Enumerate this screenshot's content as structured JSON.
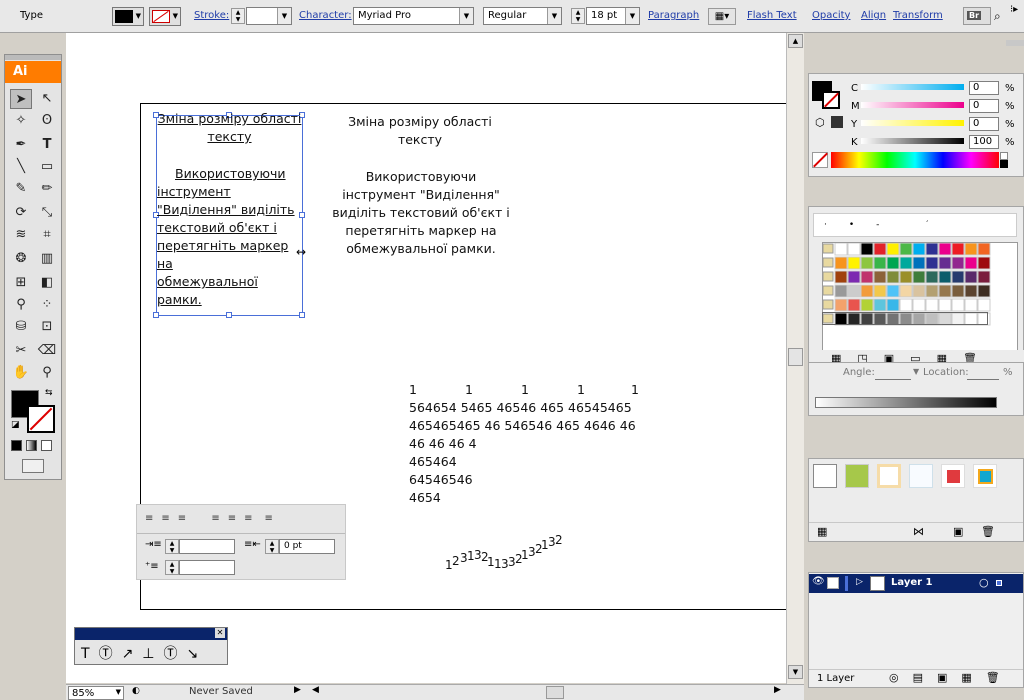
{
  "control_bar": {
    "selection_type": "Type",
    "stroke_label": "Stroke:",
    "character_label": "Character:",
    "font_family": "Myriad Pro",
    "font_style": "Regular",
    "font_size": "18 pt",
    "paragraph_label": "Paragraph",
    "flash_text_label": "Flash Text",
    "opacity_label": "Opacity",
    "align_label": "Align",
    "transform_label": "Transform",
    "bridge_label": "Br"
  },
  "tools": {
    "app_logo": "Ai"
  },
  "document": {
    "text_left": {
      "title_line1": "Зміна розміру області",
      "title_line2": "тексту",
      "body": [
        "Використовуючи",
        "інструмент",
        "\"Виділення\" виділіть",
        "текстовий об'єкт і",
        "перетягніть маркер",
        "на",
        "обмежувальної",
        "рамки."
      ]
    },
    "text_right": {
      "title_line1": "Зміна розміру області",
      "title_line2": "тексту",
      "body": [
        "Використовуючи",
        "інструмент \"Виділення\"",
        "виділіть текстовий об'єкт і",
        "перетягніть маркер на",
        "обмежувальної рамки."
      ]
    },
    "numbers_block": {
      "row1": [
        "1",
        "1",
        "1",
        "1",
        "1"
      ],
      "lines": [
        "564654 5465 46546 465 46545465",
        "465465465 46 546546 465 4646 46",
        "46 46 46 4",
        "465464",
        "64546546",
        "4654"
      ]
    },
    "path_text": [
      "1",
      "2",
      "3",
      "1",
      "3",
      "2",
      "1",
      "1",
      "3",
      "3",
      "2",
      "1",
      "3",
      "2",
      "1",
      "3",
      "2"
    ]
  },
  "paragraph_panel": {
    "indent_left_value": "",
    "indent_right_value": "0 pt",
    "first_line_value": ""
  },
  "status_bar": {
    "zoom": "85%",
    "status": "Never Saved"
  },
  "color_panel": {
    "channels": [
      {
        "label": "C",
        "value": "0",
        "unit": "%"
      },
      {
        "label": "M",
        "value": "0",
        "unit": "%"
      },
      {
        "label": "Y",
        "value": "0",
        "unit": "%"
      },
      {
        "label": "K",
        "value": "100",
        "unit": "%"
      }
    ]
  },
  "gradient_panel": {
    "angle_label": "Angle:",
    "location_label": "Location:",
    "location_unit": "%"
  },
  "layers_panel": {
    "layer_name": "Layer 1",
    "footer": "1 Layer"
  },
  "colors": {
    "accent_blue": "#0a246a",
    "selection_blue": "#4a6fd8",
    "link_blue": "#1f3ca8",
    "logo_orange": "#ff7c00"
  }
}
